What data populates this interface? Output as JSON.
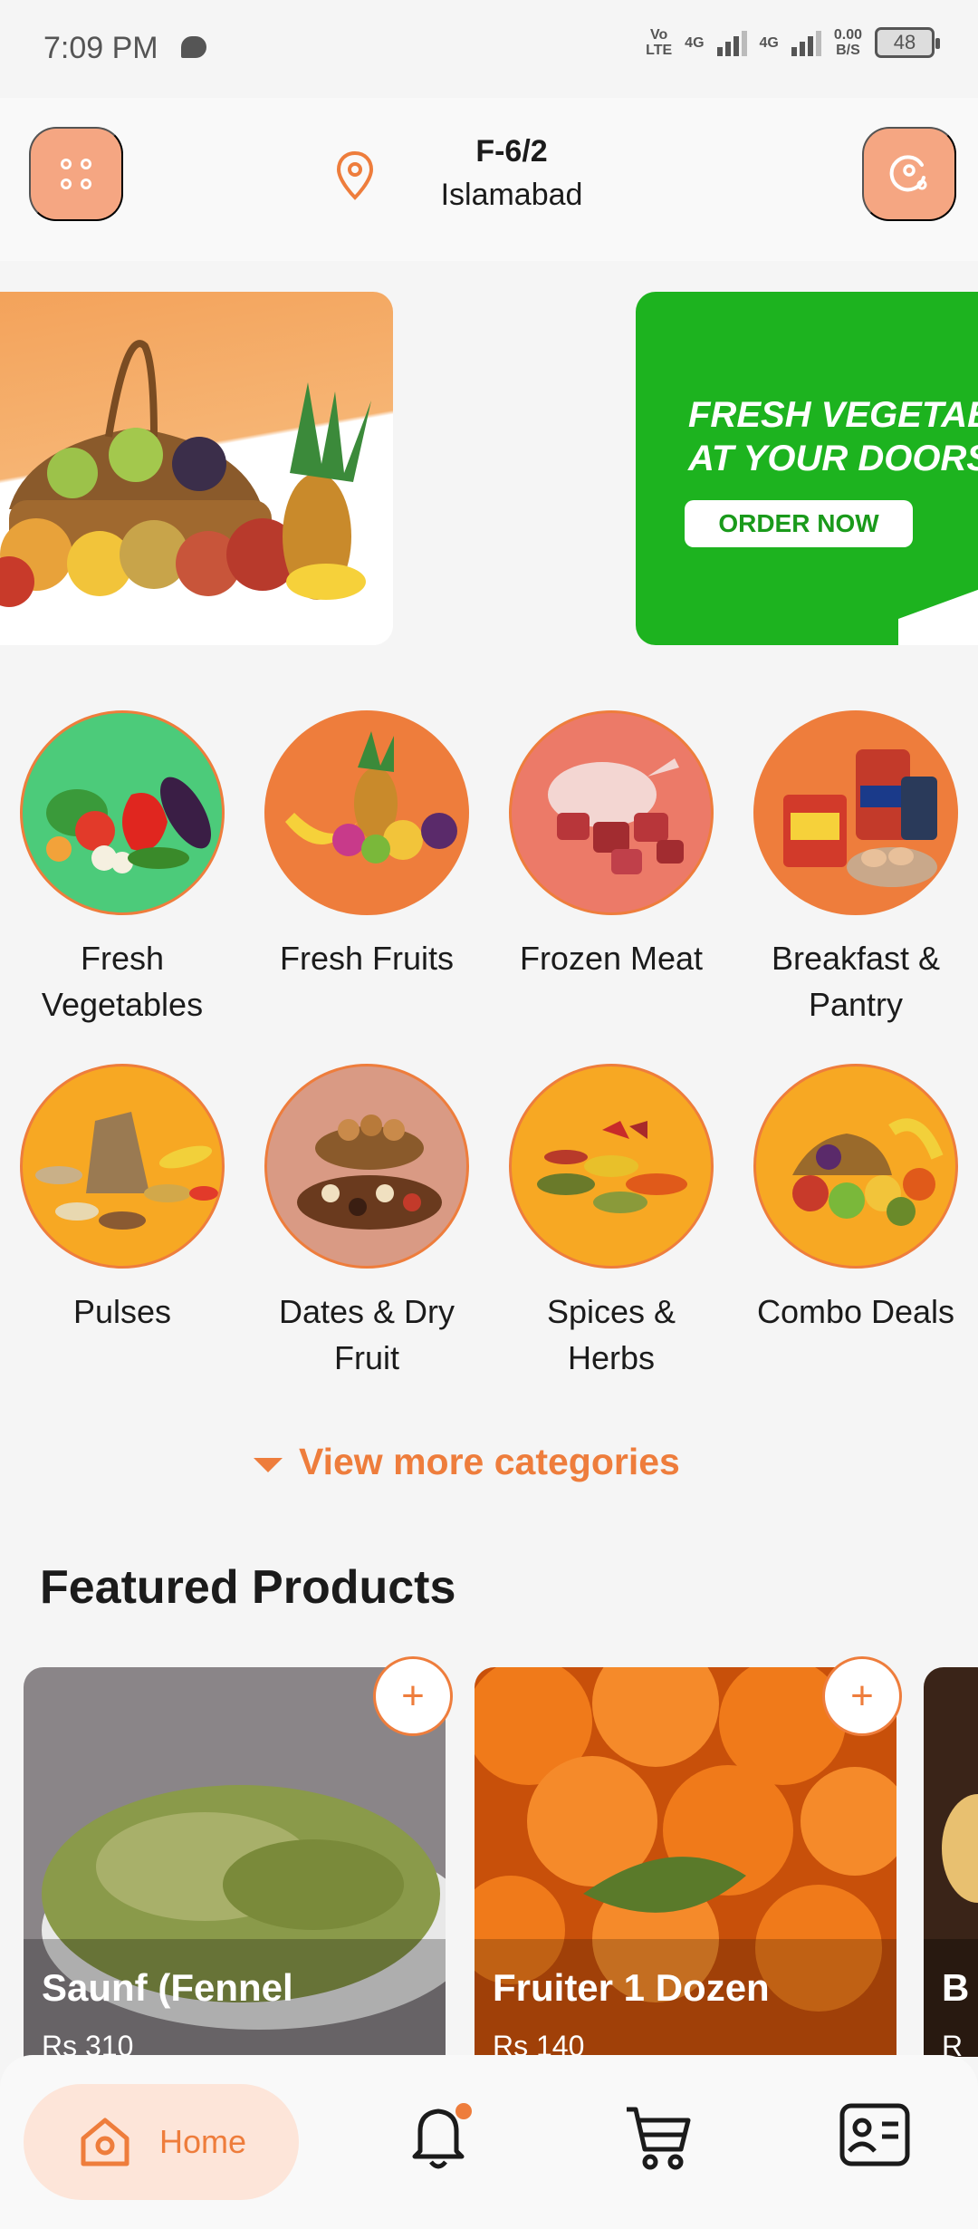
{
  "status_bar": {
    "time": "7:09 PM",
    "volte": "Vo\nLTE",
    "net1": "4G",
    "net2": "4G",
    "speed": "0.00\nB/S",
    "battery": "48"
  },
  "header": {
    "location_line1": "F-6/2",
    "location_line2": "Islamabad"
  },
  "banners": {
    "veg_text": "FRESH VEGETABLES\nAT YOUR DOORSTEP",
    "veg_button": "ORDER NOW"
  },
  "categories": [
    {
      "label": "Fresh\nVegetables",
      "color": "#4ccb7a"
    },
    {
      "label": "Fresh Fruits",
      "color": "#ee7d3c"
    },
    {
      "label": "Frozen Meat",
      "color": "#ec7a68"
    },
    {
      "label": "Breakfast &\nPantry",
      "color": "#ee7d3c"
    },
    {
      "label": "Pulses",
      "color": "#f7a823"
    },
    {
      "label": "Dates & Dry\nFruit",
      "color": "#d99a84"
    },
    {
      "label": "Spices &\nHerbs",
      "color": "#f7a823"
    },
    {
      "label": "Combo Deals",
      "color": "#f7a823"
    }
  ],
  "view_more": "View more categories",
  "featured_title": "Featured Products",
  "products": [
    {
      "name": "Saunf (Fennel",
      "price": "Rs 310"
    },
    {
      "name": "Fruiter 1 Dozen",
      "price": "Rs 140"
    },
    {
      "name": "B",
      "price": "R"
    }
  ],
  "add_label": "+",
  "nav": {
    "home_label": "Home"
  },
  "colors": {
    "accent": "#ee7d3c",
    "accent_light": "#f5a682",
    "green_banner": "#1db31f"
  }
}
